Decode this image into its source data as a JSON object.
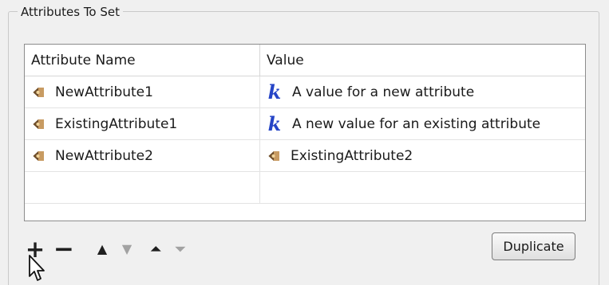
{
  "group": {
    "title": "Attributes To Set"
  },
  "table": {
    "columns": [
      "Attribute Name",
      "Value"
    ],
    "rows": [
      {
        "name": "NewAttribute1",
        "name_icon": "attribute-icon",
        "value": "A value for a new attribute",
        "value_icon": "constant-k-icon"
      },
      {
        "name": "ExistingAttribute1",
        "name_icon": "attribute-icon",
        "value": "A new value for an existing attribute",
        "value_icon": "constant-k-icon"
      },
      {
        "name": "NewAttribute2",
        "name_icon": "attribute-icon",
        "value": "ExistingAttribute2",
        "value_icon": "attribute-icon"
      },
      {
        "name": "",
        "value": ""
      }
    ]
  },
  "toolbar": {
    "add_icon": "+",
    "remove_icon": "−",
    "move_up_icon": "▲",
    "move_down_icon": "▼",
    "move_top_icon": "⏶",
    "move_bottom_icon": "⏷",
    "duplicate_label": "Duplicate"
  },
  "colors": {
    "constant_icon": "#2645c7",
    "attribute_icon": "#8d6738",
    "disabled_tool": "#a2a2a2"
  }
}
